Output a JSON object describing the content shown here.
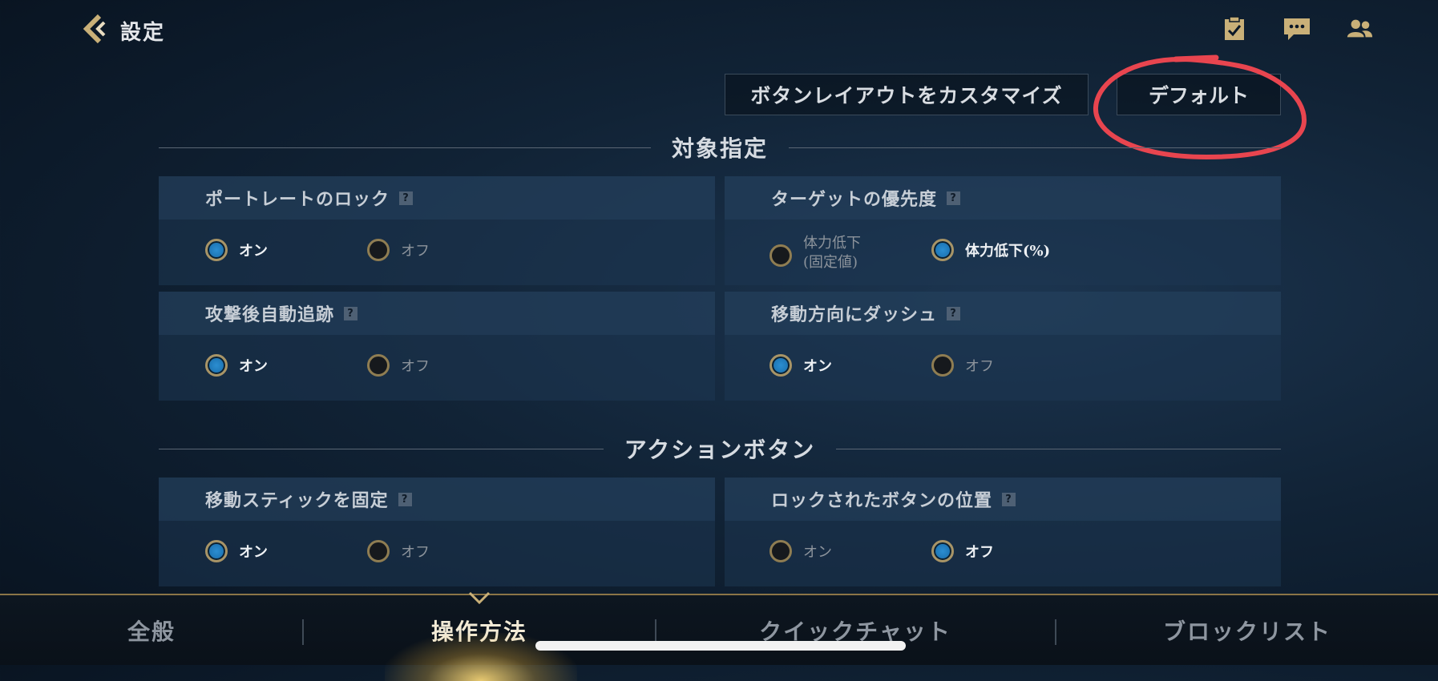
{
  "header": {
    "title": "設定",
    "icons": [
      "checklist-icon",
      "chat-icon",
      "friends-icon"
    ]
  },
  "buttons": {
    "customize_label": "ボタンレイアウトをカスタマイズ",
    "default_label": "デフォルト"
  },
  "sections": [
    {
      "title": "対象指定"
    },
    {
      "title": "アクションボタン"
    }
  ],
  "settings": [
    {
      "title": "ポートレートのロック",
      "options": [
        "オン",
        "オフ"
      ],
      "selected": "オン"
    },
    {
      "title": "ターゲットの優先度",
      "options": [
        "体力低下\n(固定値)",
        "体力低下(%)"
      ],
      "selected": "体力低下(%)"
    },
    {
      "title": "攻撃後自動追跡",
      "options": [
        "オン",
        "オフ"
      ],
      "selected": "オン"
    },
    {
      "title": "移動方向にダッシュ",
      "options": [
        "オン",
        "オフ"
      ],
      "selected": "オン"
    },
    {
      "title": "移動スティックを固定",
      "options": [
        "オン",
        "オフ"
      ],
      "selected": "オン"
    },
    {
      "title": "ロックされたボタンの位置",
      "options": [
        "オン",
        "オフ"
      ],
      "selected": "オフ"
    }
  ],
  "tabs": [
    {
      "label": "全般"
    },
    {
      "label": "操作方法",
      "active": true
    },
    {
      "label": "クイックチャット"
    },
    {
      "label": "ブロックリスト"
    }
  ],
  "colors": {
    "accent_gold": "#a89466",
    "radio_on_blue": "#1f78b8",
    "annotation_red": "#e8454f"
  }
}
